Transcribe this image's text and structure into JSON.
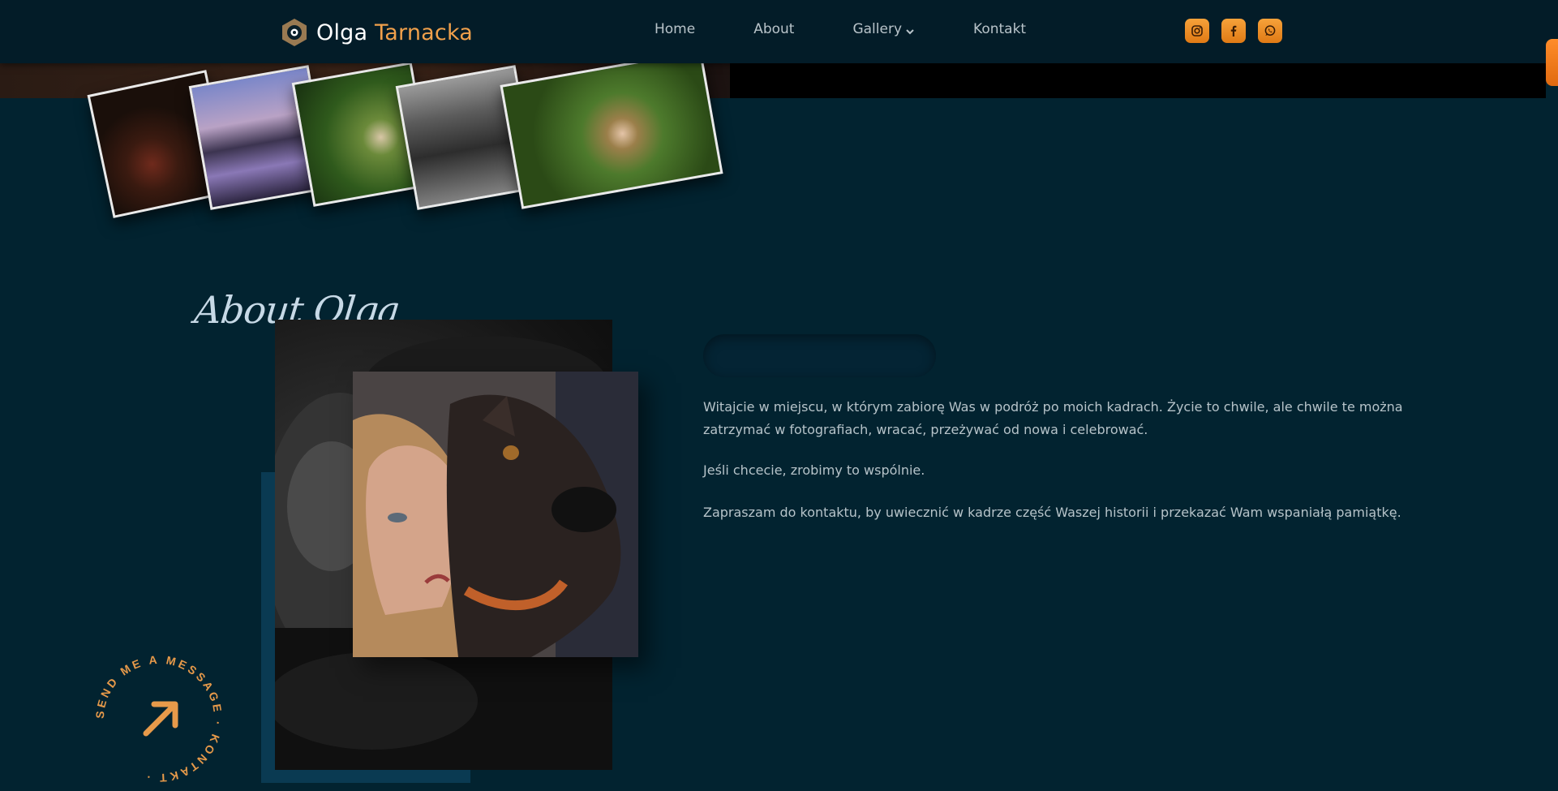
{
  "header": {
    "logo_first": "Olga",
    "logo_last": "Tarnacka",
    "nav": [
      {
        "label": "Home"
      },
      {
        "label": "About"
      },
      {
        "label": "Gallery"
      },
      {
        "label": "Kontakt"
      }
    ],
    "socials": [
      "instagram-icon",
      "facebook-icon",
      "whatsapp-icon"
    ]
  },
  "about": {
    "title": "About Olga",
    "paragraphs": [
      "Witajcie w miejscu, w którym zabiorę Was w podróż po moich kadrach. Życie to chwile, ale chwile te można zatrzymać w fotografiach, wracać, przeżywać od nowa i celebrować.",
      "Jeśli chcecie, zrobimy to wspólnie.",
      "Zapraszam do kontaktu, by uwiecznić w kadrze część Waszej historii i przekazać Wam wspaniałą pamiątkę."
    ]
  },
  "badge": {
    "circle_text": "SEND ME A MESSAGE · KONTAKT ·"
  },
  "colors": {
    "background": "#022330",
    "header": "#031c28",
    "accent": "#f0a04b"
  }
}
